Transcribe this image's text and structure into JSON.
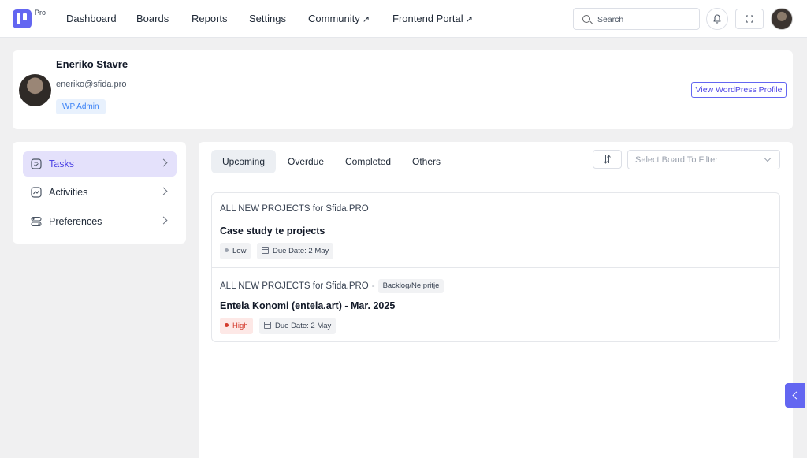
{
  "brand": {
    "tag": "Pro",
    "accent": "#6366f1"
  },
  "nav": {
    "items": [
      {
        "label": "Dashboard",
        "external": false
      },
      {
        "label": "Boards",
        "external": false
      },
      {
        "label": "Reports",
        "external": false
      },
      {
        "label": "Settings",
        "external": false
      },
      {
        "label": "Community",
        "external": true
      },
      {
        "label": "Frontend Portal",
        "external": true
      }
    ],
    "external_glyph": "↗"
  },
  "search": {
    "placeholder": "Search",
    "value": ""
  },
  "profile": {
    "name": "Eneriko Stavre",
    "email": "eneriko@sfida.pro",
    "role": "WP Admin",
    "wp_button": "View WordPress Profile"
  },
  "sidebar": {
    "items": [
      {
        "label": "Tasks",
        "icon": "tasks-icon",
        "active": true
      },
      {
        "label": "Activities",
        "icon": "activity-icon",
        "active": false
      },
      {
        "label": "Preferences",
        "icon": "preferences-icon",
        "active": false
      }
    ]
  },
  "tabs": [
    {
      "label": "Upcoming",
      "active": true
    },
    {
      "label": "Overdue",
      "active": false
    },
    {
      "label": "Completed",
      "active": false
    },
    {
      "label": "Others",
      "active": false
    }
  ],
  "filter": {
    "placeholder": "Select Board To Filter"
  },
  "tasks": [
    {
      "board": "ALL NEW PROJECTS for Sfida.PRO",
      "stage": "",
      "title": "Case study te projects",
      "priority": "Low",
      "priority_color": "#9ca3af",
      "due": "Due Date: 2 May"
    },
    {
      "board": "ALL NEW PROJECTS for Sfida.PRO",
      "separator": "-",
      "stage": "Backlog/Ne pritje",
      "title": "Entela Konomi (entela.art) - Mar. 2025",
      "priority": "High",
      "priority_color": "#d33a2c",
      "due": "Due Date: 2 May"
    }
  ]
}
